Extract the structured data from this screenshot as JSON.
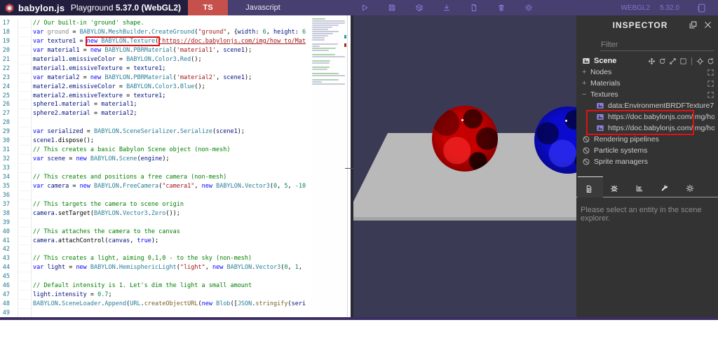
{
  "colors": {
    "header_bg": "#231e3d",
    "header_right_bg": "#463f70",
    "ts_red": "#c5504c",
    "toolbar_icon": "#8b7fd9",
    "annotation_red": "#e01212",
    "canvas_bg": "#3a3a55",
    "ground_gray": "#b9b9b9",
    "inspector_bg": "#333333",
    "sphere_red": "#c40000",
    "sphere_blue": "#0b0bd0"
  },
  "header": {
    "logo_text": "babylon.js",
    "title_normal": "Playground ",
    "title_bold": "5.37.0 (WebGL2)",
    "ts_label": "TS",
    "language_label": "Javascript",
    "toolbar_icons": [
      "play-icon",
      "save-icon",
      "package-icon",
      "download-icon",
      "new-file-icon",
      "trash-icon",
      "settings-icon"
    ],
    "webgl_label": "WEBGL2",
    "engine_version": "5.32.0",
    "docs_icon": "book-icon"
  },
  "editor": {
    "lines": [
      {
        "n": 17,
        "segs": [
          [
            "c",
            "// Our built-in 'ground' shape."
          ]
        ]
      },
      {
        "n": 18,
        "segs": [
          [
            "k",
            "var"
          ],
          [
            "p",
            " "
          ],
          [
            "g",
            "ground"
          ],
          [
            "p",
            " = "
          ],
          [
            "t",
            "BABYLON"
          ],
          [
            "p",
            "."
          ],
          [
            "t",
            "MeshBuilder"
          ],
          [
            "p",
            "."
          ],
          [
            "t",
            "CreateGround"
          ],
          [
            "p",
            "("
          ],
          [
            "s",
            "\"ground\""
          ],
          [
            "p",
            ", {"
          ],
          [
            "i",
            "width"
          ],
          [
            "p",
            ": "
          ],
          [
            "n",
            "6"
          ],
          [
            "p",
            ", "
          ],
          [
            "i",
            "height"
          ],
          [
            "p",
            ": "
          ],
          [
            "n",
            "6"
          ]
        ]
      },
      {
        "n": 19,
        "segs": [
          [
            "k",
            "var"
          ],
          [
            "p",
            " "
          ],
          [
            "i",
            "texture1"
          ],
          [
            "p",
            " = "
          ],
          [
            "box",
            [
              [
                "k",
                "new"
              ],
              [
                "p",
                " "
              ],
              [
                "t",
                "BABYLON"
              ],
              [
                "p",
                "."
              ],
              [
                "t",
                "Texture"
              ],
              [
                "p",
                "("
              ]
            ]
          ],
          [
            "u",
            "'https://doc.babylonjs.com/img/how_to/Mat"
          ]
        ]
      },
      {
        "n": 20,
        "segs": [
          [
            "k",
            "var"
          ],
          [
            "p",
            " "
          ],
          [
            "i",
            "material1"
          ],
          [
            "p",
            " = "
          ],
          [
            "k",
            "new"
          ],
          [
            "p",
            " "
          ],
          [
            "t",
            "BABYLON"
          ],
          [
            "p",
            "."
          ],
          [
            "t",
            "PBRMaterial"
          ],
          [
            "p",
            "("
          ],
          [
            "s",
            "'material1'"
          ],
          [
            "p",
            ", "
          ],
          [
            "i",
            "scene1"
          ],
          [
            "p",
            ");"
          ]
        ]
      },
      {
        "n": 21,
        "segs": [
          [
            "i",
            "material1"
          ],
          [
            "p",
            "."
          ],
          [
            "i",
            "emissiveColor"
          ],
          [
            "p",
            " = "
          ],
          [
            "t",
            "BABYLON"
          ],
          [
            "p",
            "."
          ],
          [
            "t",
            "Color3"
          ],
          [
            "p",
            "."
          ],
          [
            "t",
            "Red"
          ],
          [
            "p",
            "();"
          ]
        ]
      },
      {
        "n": 22,
        "segs": [
          [
            "i",
            "material1"
          ],
          [
            "p",
            "."
          ],
          [
            "i",
            "emissiveTexture"
          ],
          [
            "p",
            " = "
          ],
          [
            "i",
            "texture1"
          ],
          [
            "p",
            ";"
          ]
        ]
      },
      {
        "n": 23,
        "segs": [
          [
            "k",
            "var"
          ],
          [
            "p",
            " "
          ],
          [
            "i",
            "material2"
          ],
          [
            "p",
            " = "
          ],
          [
            "k",
            "new"
          ],
          [
            "p",
            " "
          ],
          [
            "t",
            "BABYLON"
          ],
          [
            "p",
            "."
          ],
          [
            "t",
            "PBRMaterial"
          ],
          [
            "p",
            "("
          ],
          [
            "s",
            "'material2'"
          ],
          [
            "p",
            ", "
          ],
          [
            "i",
            "scene1"
          ],
          [
            "p",
            ");"
          ]
        ]
      },
      {
        "n": 24,
        "segs": [
          [
            "i",
            "material2"
          ],
          [
            "p",
            "."
          ],
          [
            "i",
            "emissiveColor"
          ],
          [
            "p",
            " = "
          ],
          [
            "t",
            "BABYLON"
          ],
          [
            "p",
            "."
          ],
          [
            "t",
            "Color3"
          ],
          [
            "p",
            "."
          ],
          [
            "t",
            "Blue"
          ],
          [
            "p",
            "();"
          ]
        ]
      },
      {
        "n": 25,
        "segs": [
          [
            "i",
            "material2"
          ],
          [
            "p",
            "."
          ],
          [
            "i",
            "emissiveTexture"
          ],
          [
            "p",
            " = "
          ],
          [
            "i",
            "texture1"
          ],
          [
            "p",
            ";"
          ]
        ]
      },
      {
        "n": 26,
        "segs": [
          [
            "i",
            "sphere1"
          ],
          [
            "p",
            "."
          ],
          [
            "i",
            "material"
          ],
          [
            "p",
            " = "
          ],
          [
            "i",
            "material1"
          ],
          [
            "p",
            ";"
          ]
        ]
      },
      {
        "n": 27,
        "segs": [
          [
            "i",
            "sphere2"
          ],
          [
            "p",
            "."
          ],
          [
            "i",
            "material"
          ],
          [
            "p",
            " = "
          ],
          [
            "i",
            "material2"
          ],
          [
            "p",
            ";"
          ]
        ]
      },
      {
        "n": 28,
        "segs": []
      },
      {
        "n": 29,
        "segs": [
          [
            "k",
            "var"
          ],
          [
            "p",
            " "
          ],
          [
            "i",
            "serialized"
          ],
          [
            "p",
            " = "
          ],
          [
            "t",
            "BABYLON"
          ],
          [
            "p",
            "."
          ],
          [
            "t",
            "SceneSerializer"
          ],
          [
            "p",
            "."
          ],
          [
            "t",
            "Serialize"
          ],
          [
            "p",
            "("
          ],
          [
            "i",
            "scene1"
          ],
          [
            "p",
            ");"
          ]
        ]
      },
      {
        "n": 30,
        "segs": [
          [
            "i",
            "scene1"
          ],
          [
            "p",
            ".dispose();"
          ]
        ]
      },
      {
        "n": 31,
        "segs": [
          [
            "c",
            "// This creates a basic Babylon Scene object (non-mesh)"
          ]
        ]
      },
      {
        "n": 32,
        "segs": [
          [
            "k",
            "var"
          ],
          [
            "p",
            " "
          ],
          [
            "i",
            "scene"
          ],
          [
            "p",
            " = "
          ],
          [
            "k",
            "new"
          ],
          [
            "p",
            " "
          ],
          [
            "t",
            "BABYLON"
          ],
          [
            "p",
            "."
          ],
          [
            "t",
            "Scene"
          ],
          [
            "p",
            "("
          ],
          [
            "i",
            "engine"
          ],
          [
            "p",
            ");"
          ]
        ]
      },
      {
        "n": 33,
        "segs": []
      },
      {
        "n": 34,
        "segs": [
          [
            "c",
            "// This creates and positions a free camera (non-mesh)"
          ]
        ]
      },
      {
        "n": 35,
        "segs": [
          [
            "k",
            "var"
          ],
          [
            "p",
            " "
          ],
          [
            "i",
            "camera"
          ],
          [
            "p",
            " = "
          ],
          [
            "k",
            "new"
          ],
          [
            "p",
            " "
          ],
          [
            "t",
            "BABYLON"
          ],
          [
            "p",
            "."
          ],
          [
            "t",
            "FreeCamera"
          ],
          [
            "p",
            "("
          ],
          [
            "s",
            "\"camera1\""
          ],
          [
            "p",
            ", "
          ],
          [
            "k",
            "new"
          ],
          [
            "p",
            " "
          ],
          [
            "t",
            "BABYLON"
          ],
          [
            "p",
            "."
          ],
          [
            "t",
            "Vector3"
          ],
          [
            "p",
            "("
          ],
          [
            "n",
            "0"
          ],
          [
            "p",
            ", "
          ],
          [
            "n",
            "5"
          ],
          [
            "p",
            ", "
          ],
          [
            "n",
            "-10"
          ]
        ]
      },
      {
        "n": 36,
        "segs": []
      },
      {
        "n": 37,
        "segs": [
          [
            "c",
            "// This targets the camera to scene origin"
          ]
        ]
      },
      {
        "n": 38,
        "segs": [
          [
            "i",
            "camera"
          ],
          [
            "p",
            ".setTarget("
          ],
          [
            "t",
            "BABYLON"
          ],
          [
            "p",
            "."
          ],
          [
            "t",
            "Vector3"
          ],
          [
            "p",
            "."
          ],
          [
            "t",
            "Zero"
          ],
          [
            "p",
            "());"
          ]
        ]
      },
      {
        "n": 39,
        "segs": []
      },
      {
        "n": 40,
        "segs": [
          [
            "c",
            "// This attaches the camera to the canvas"
          ]
        ]
      },
      {
        "n": 41,
        "segs": [
          [
            "i",
            "camera"
          ],
          [
            "p",
            ".attachControl("
          ],
          [
            "i",
            "canvas"
          ],
          [
            "p",
            ", "
          ],
          [
            "k",
            "true"
          ],
          [
            "p",
            ");"
          ]
        ]
      },
      {
        "n": 42,
        "segs": []
      },
      {
        "n": 43,
        "segs": [
          [
            "c",
            "// This creates a light, aiming 0,1,0 - to the sky (non-mesh)"
          ]
        ]
      },
      {
        "n": 44,
        "segs": [
          [
            "k",
            "var"
          ],
          [
            "p",
            " "
          ],
          [
            "i",
            "light"
          ],
          [
            "p",
            " = "
          ],
          [
            "k",
            "new"
          ],
          [
            "p",
            " "
          ],
          [
            "t",
            "BABYLON"
          ],
          [
            "p",
            "."
          ],
          [
            "t",
            "HemisphericLight"
          ],
          [
            "p",
            "("
          ],
          [
            "s",
            "\"light\""
          ],
          [
            "p",
            ", "
          ],
          [
            "k",
            "new"
          ],
          [
            "p",
            " "
          ],
          [
            "t",
            "BABYLON"
          ],
          [
            "p",
            "."
          ],
          [
            "t",
            "Vector3"
          ],
          [
            "p",
            "("
          ],
          [
            "n",
            "0"
          ],
          [
            "p",
            ", "
          ],
          [
            "n",
            "1"
          ],
          [
            "p",
            ","
          ]
        ]
      },
      {
        "n": 45,
        "segs": []
      },
      {
        "n": 46,
        "segs": [
          [
            "c",
            "// Default intensity is 1. Let's dim the light a small amount"
          ]
        ]
      },
      {
        "n": 47,
        "segs": [
          [
            "i",
            "light"
          ],
          [
            "p",
            "."
          ],
          [
            "i",
            "intensity"
          ],
          [
            "p",
            " = "
          ],
          [
            "n",
            "0.7"
          ],
          [
            "p",
            ";"
          ]
        ]
      },
      {
        "n": 48,
        "segs": [
          [
            "t",
            "BABYLON"
          ],
          [
            "p",
            "."
          ],
          [
            "t",
            "SceneLoader"
          ],
          [
            "p",
            "."
          ],
          [
            "t",
            "Append"
          ],
          [
            "p",
            "("
          ],
          [
            "t",
            "URL"
          ],
          [
            "p",
            "."
          ],
          [
            "m",
            "createObjectURL"
          ],
          [
            "p",
            "("
          ],
          [
            "k",
            "new"
          ],
          [
            "p",
            " "
          ],
          [
            "t",
            "Blob"
          ],
          [
            "p",
            "(["
          ],
          [
            "t",
            "JSON"
          ],
          [
            "p",
            "."
          ],
          [
            "m",
            "stringify"
          ],
          [
            "p",
            "("
          ],
          [
            "i",
            "seri"
          ]
        ]
      },
      {
        "n": 49,
        "segs": []
      }
    ]
  },
  "scene_view": {
    "objects": [
      "ground-plane",
      "red-sphere",
      "blue-sphere"
    ]
  },
  "inspector": {
    "title": "INSPECTOR",
    "window_icons": [
      "popup-icon",
      "close-icon"
    ],
    "filter_placeholder": "Filter",
    "rows": [
      {
        "kind": "scene",
        "icon": "image-icon",
        "label": "Scene",
        "gizmos": [
          "move-icon",
          "rotate-icon",
          "scale-icon",
          "bounds-icon",
          "pick-icon",
          "refresh-icon"
        ]
      },
      {
        "kind": "group",
        "toggle": "+",
        "label": "Nodes",
        "right_icon": "expand-icon"
      },
      {
        "kind": "group",
        "toggle": "+",
        "label": "Materials",
        "right_icon": "expand-icon"
      },
      {
        "kind": "group",
        "toggle": "−",
        "label": "Textures",
        "right_icon": "expand-icon"
      },
      {
        "kind": "texture",
        "icon": "image-icon",
        "label": "data:EnvironmentBRDFTexture7"
      },
      {
        "kind": "texture",
        "icon": "image-icon",
        "label": "https://doc.babylonjs.com/img/ho...",
        "highlight": true
      },
      {
        "kind": "texture",
        "icon": "image-icon",
        "label": "https://doc.babylonjs.com/img/ho...",
        "highlight": true
      },
      {
        "kind": "empty",
        "icon": "no-entry-icon",
        "label": "Rendering pipelines"
      },
      {
        "kind": "empty",
        "icon": "no-entry-icon",
        "label": "Particle systems"
      },
      {
        "kind": "empty",
        "icon": "no-entry-icon",
        "label": "Sprite managers"
      }
    ],
    "tabs": [
      {
        "icon": "file-text-icon",
        "active": true
      },
      {
        "icon": "bug-icon",
        "active": false
      },
      {
        "icon": "stats-icon",
        "active": false
      },
      {
        "icon": "wrench-icon",
        "active": false
      },
      {
        "icon": "gear-icon",
        "active": false
      }
    ],
    "empty_message": "Please select an entity in the scene explorer."
  }
}
